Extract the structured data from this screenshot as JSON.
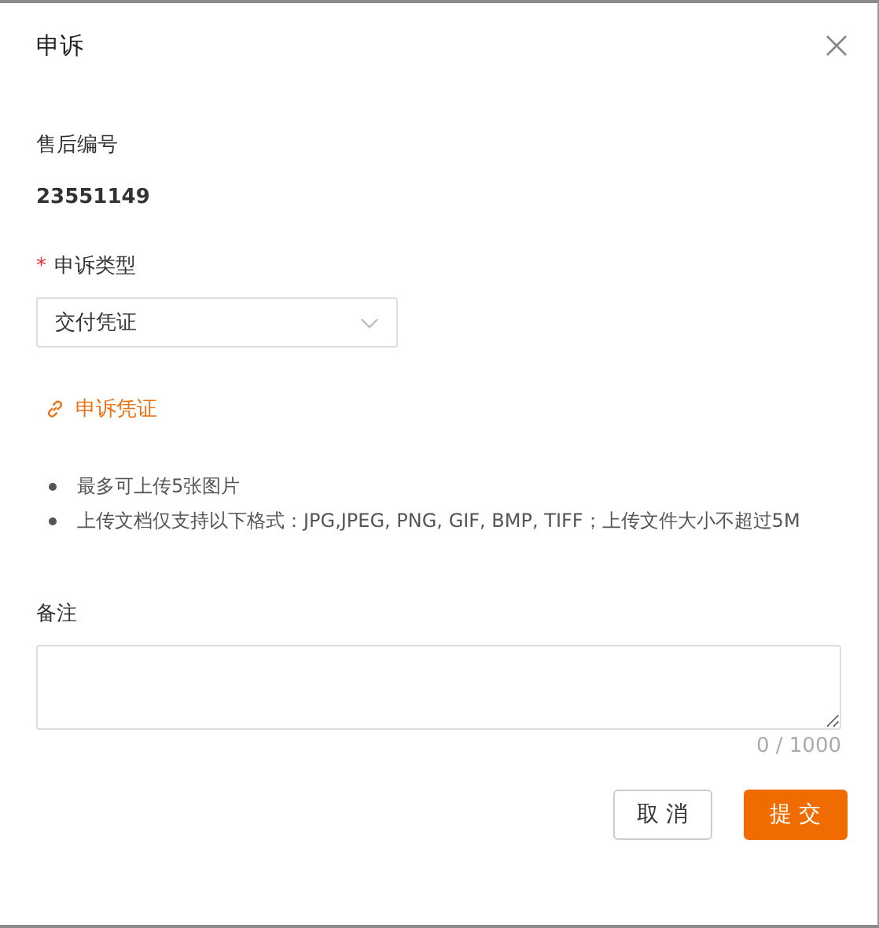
{
  "dialog": {
    "title": "申诉"
  },
  "fields": [
    {
      "kind": "readonly",
      "label": "售后编号",
      "required": false,
      "value": "23551149"
    },
    {
      "kind": "select",
      "label": "申诉类型",
      "required": true,
      "value": "交付凭证"
    }
  ],
  "required_mark": "*",
  "upload_link": {
    "label": "申诉凭证"
  },
  "notes": [
    "最多可上传5张图片",
    "上传文档仅支持以下格式：JPG,JPEG, PNG, GIF, BMP, TIFF；上传文件大小不超过5M"
  ],
  "remark": {
    "label": "备注",
    "counter": "0 / 1000"
  },
  "buttons": [
    {
      "kind": "secondary",
      "label": "取 消"
    },
    {
      "kind": "primary",
      "label": "提 交"
    }
  ]
}
